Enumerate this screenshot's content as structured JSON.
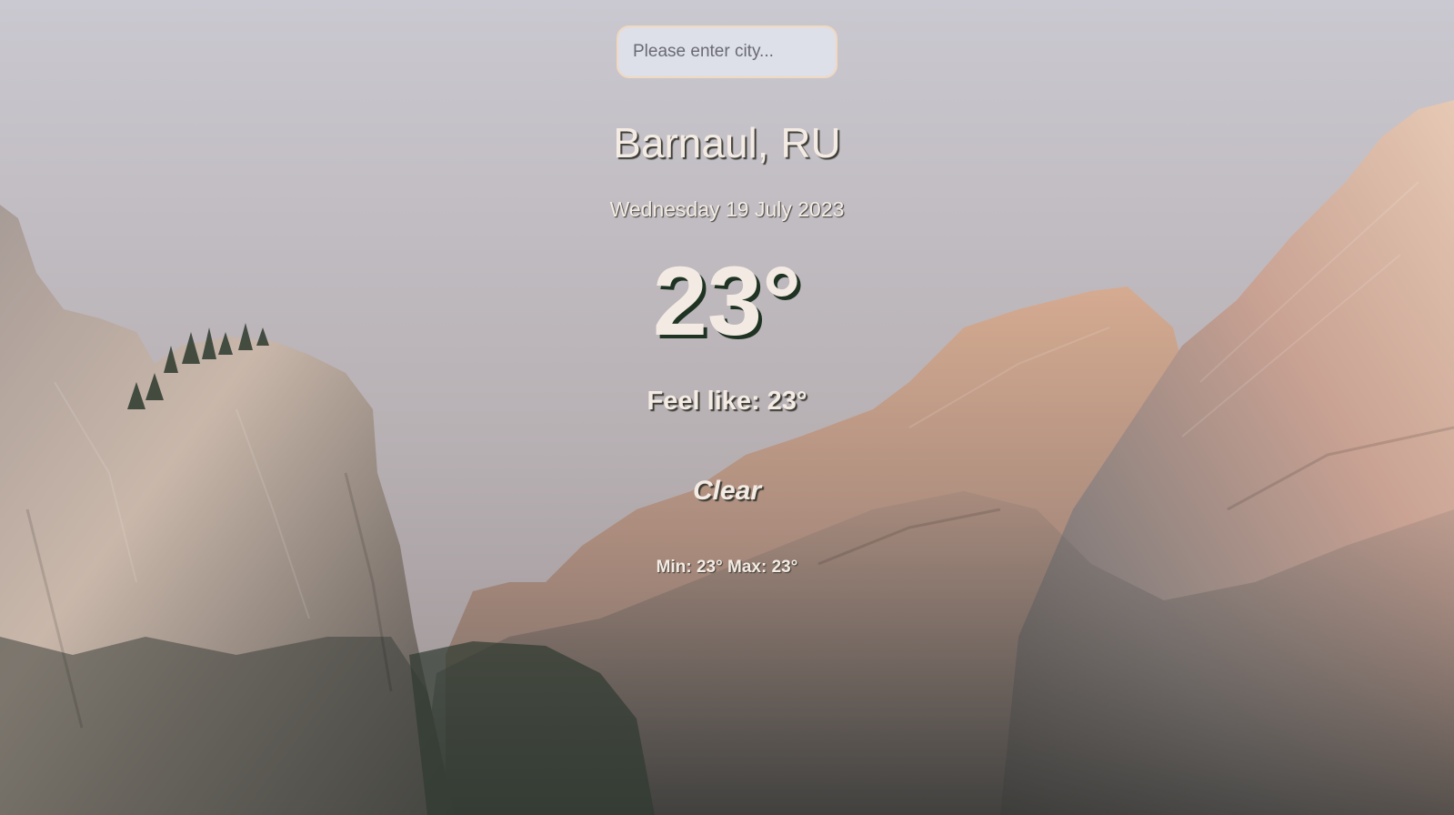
{
  "search": {
    "placeholder": "Please enter city...",
    "value": ""
  },
  "location": {
    "name": "Barnaul, RU"
  },
  "date": "Wednesday 19 July 2023",
  "temperature": "23°",
  "feels_like": "Feel like: 23°",
  "condition": "Clear",
  "min_max": "Min: 23° Max: 23°",
  "colors": {
    "text": "#f3ebe3",
    "text_shadow": "#3b3b33",
    "temp_shadow": "#1f3323",
    "input_border": "#f1d8bf",
    "input_bg": "#dee1ec"
  },
  "background": {
    "subject": "mountain-landscape-image"
  }
}
